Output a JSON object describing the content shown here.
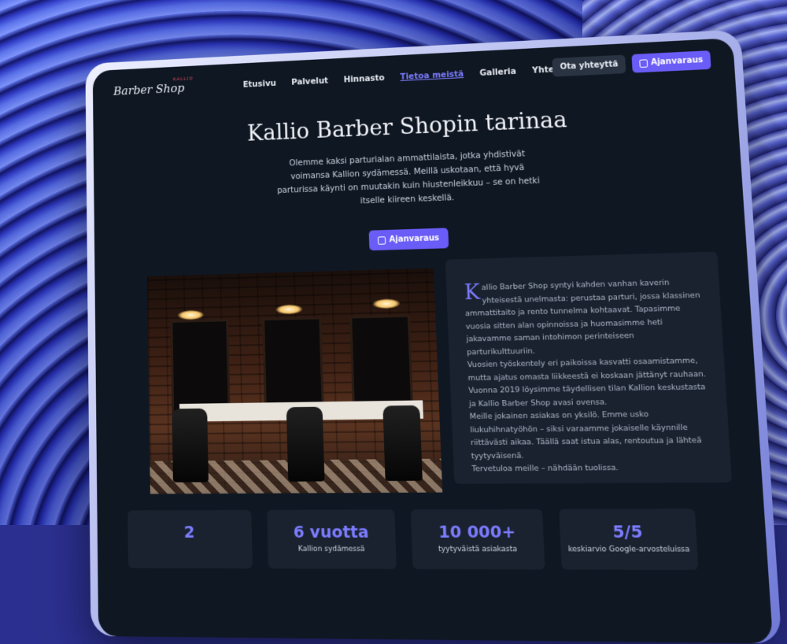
{
  "nav": {
    "logo": "Barber Shop",
    "logo_sub": "KALLIO",
    "links": [
      "Etusivu",
      "Palvelut",
      "Hinnasto",
      "Tietoa meistä",
      "Galleria",
      "Yhteystiedot"
    ],
    "contact_button": "Ota yhteyttä",
    "book_button": "Ajanvaraus"
  },
  "hero": {
    "title": "Kallio Barber Shopin tarinaa",
    "lead": "Olemme kaksi parturialan ammattilaista, jotka yhdistivät voimansa Kallion sydämessä. Meillä uskotaan, että hyvä parturissa käynti on muutakin kuin hiustenleikkuu – se on hetki itselle kiireen keskellä.",
    "cta": "Ajanvaraus"
  },
  "story": {
    "dropcap": "K",
    "paragraphs": [
      "allio Barber Shop syntyi kahden vanhan kaverin yhteisestä unelmasta: perustaa parturi, jossa klassinen ammattitaito ja rento tunnelma kohtaavat. Tapasimme vuosia sitten alan opinnoissa ja huomasimme heti jakavamme saman intohimon perinteiseen parturikulttuuriin.",
      "Vuosien työskentely eri paikoissa kasvatti osaamistamme, mutta ajatus omasta liikkeestä ei koskaan jättänyt rauhaan. Vuonna 2019 löysimme täydellisen tilan Kallion keskustasta ja Kallio Barber Shop avasi ovensa.",
      "Meille jokainen asiakas on yksilö. Emme usko liukuhihnatyöhön – siksi varaamme jokaiselle käynnille riittävästi aikaa. Täällä saat istua alas, rentoutua ja lähteä tyytyväisenä.",
      "Tervetuloa meille – nähdään tuolissa."
    ]
  },
  "stats": [
    {
      "value": "2",
      "label": ""
    },
    {
      "value": "6 vuotta",
      "label": "Kallion sydämessä"
    },
    {
      "value": "10 000+",
      "label": "tyytyväistä asiakasta"
    },
    {
      "value": "5/5",
      "label": "keskiarvio Google-arvosteluissa"
    }
  ]
}
